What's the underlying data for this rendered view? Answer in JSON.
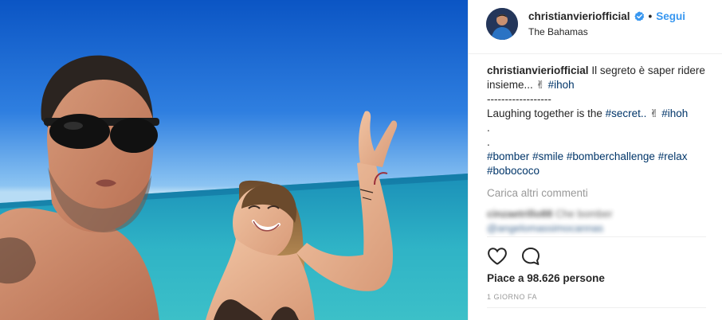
{
  "photo": {
    "alt": "Selfie on a beach with sea and blue sky"
  },
  "header": {
    "username": "christianvieriofficial",
    "follow_label": "Segui",
    "separator": "•",
    "location": "The Bahamas"
  },
  "caption": {
    "username": "christianvieriofficial",
    "text_part1": "Il segreto è saper ridere insieme...",
    "emoji": "✌",
    "hashtag1": "#ihoh",
    "dashes": "------------------",
    "text_part2": "Laughing together is the",
    "hashtag_secret": "#secret..",
    "emoji2": "✌",
    "hashtag2": "#ihoh",
    "dot1": ".",
    "dot2": ".",
    "tags_line1": [
      "#bomber",
      "#smile",
      "#bomberchallenge",
      "#relax"
    ],
    "tags_line2": [
      "#bobococo"
    ]
  },
  "comments": {
    "load_more": "Carica altri commenti",
    "blurred_user": "cinzaetrillo88",
    "blurred_text": "Che bomber",
    "blurred_tag": "@angelomassimocannas"
  },
  "stats": {
    "likes": "Piace a 98.626 persone",
    "time_ago": "1 GIORNO FA"
  },
  "icons": {
    "verified": "verified-badge-icon",
    "like": "heart-icon",
    "comment": "comment-bubble-icon"
  },
  "colors": {
    "link": "#3897f0",
    "hashtag": "#003569",
    "muted": "#999999",
    "verified": "#3897f0"
  }
}
